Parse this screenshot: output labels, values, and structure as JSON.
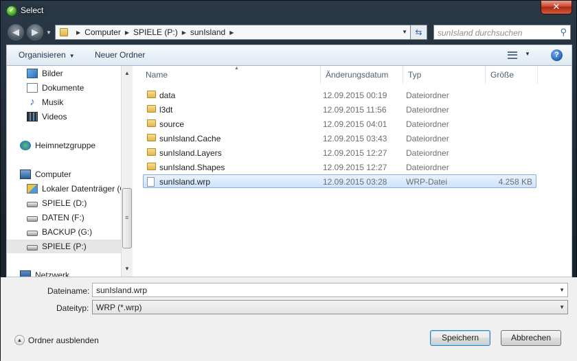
{
  "window": {
    "title": "Select",
    "close_glyph": "✕"
  },
  "nav": {
    "back_glyph": "◀",
    "forward_glyph": "▶",
    "breadcrumb": [
      "Computer",
      "SPIELE (P:)",
      "sunIsland"
    ],
    "search_placeholder": "sunIsland durchsuchen"
  },
  "toolbar": {
    "organize": "Organisieren",
    "new_folder": "Neuer Ordner",
    "help": "?"
  },
  "navpane": {
    "items": [
      {
        "label": "Bilder",
        "icon": "pictures-icon"
      },
      {
        "label": "Dokumente",
        "icon": "documents-icon"
      },
      {
        "label": "Musik",
        "icon": "music-icon"
      },
      {
        "label": "Videos",
        "icon": "videos-icon"
      },
      {
        "label": "Heimnetzgruppe",
        "icon": "homegroup-icon"
      },
      {
        "label": "Computer",
        "icon": "computer-icon"
      },
      {
        "label": "Lokaler Datenträger (C",
        "icon": "windows-drive-icon"
      },
      {
        "label": "SPIELE (D:)",
        "icon": "drive-icon"
      },
      {
        "label": "DATEN (F:)",
        "icon": "drive-icon"
      },
      {
        "label": "BACKUP (G:)",
        "icon": "drive-icon"
      },
      {
        "label": "SPIELE (P:)",
        "icon": "drive-icon",
        "selected": true
      },
      {
        "label": "Netzwerk",
        "icon": "network-icon"
      }
    ]
  },
  "columns": {
    "name": "Name",
    "date": "Änderungsdatum",
    "type": "Typ",
    "size": "Größe"
  },
  "files": [
    {
      "name": "data",
      "date": "12.09.2015 00:19",
      "type": "Dateiordner",
      "size": "",
      "kind": "folder"
    },
    {
      "name": "l3dt",
      "date": "12.09.2015 11:56",
      "type": "Dateiordner",
      "size": "",
      "kind": "folder"
    },
    {
      "name": "source",
      "date": "12.09.2015 04:01",
      "type": "Dateiordner",
      "size": "",
      "kind": "folder"
    },
    {
      "name": "sunIsland.Cache",
      "date": "12.09.2015 03:43",
      "type": "Dateiordner",
      "size": "",
      "kind": "folder"
    },
    {
      "name": "sunIsland.Layers",
      "date": "12.09.2015 12:27",
      "type": "Dateiordner",
      "size": "",
      "kind": "folder"
    },
    {
      "name": "sunIsland.Shapes",
      "date": "12.09.2015 12:27",
      "type": "Dateiordner",
      "size": "",
      "kind": "folder"
    },
    {
      "name": "sunIsland.wrp",
      "date": "12.09.2015 03:28",
      "type": "WRP-Datei",
      "size": "4.258 KB",
      "kind": "file",
      "selected": true
    }
  ],
  "bottom": {
    "filename_label": "Dateiname:",
    "filename_value": "sunIsland.wrp",
    "filetype_label": "Dateityp:",
    "filetype_value": "WRP (*.wrp)",
    "hide_folders": "Ordner ausblenden",
    "save": "Speichern",
    "cancel": "Abbrechen"
  }
}
